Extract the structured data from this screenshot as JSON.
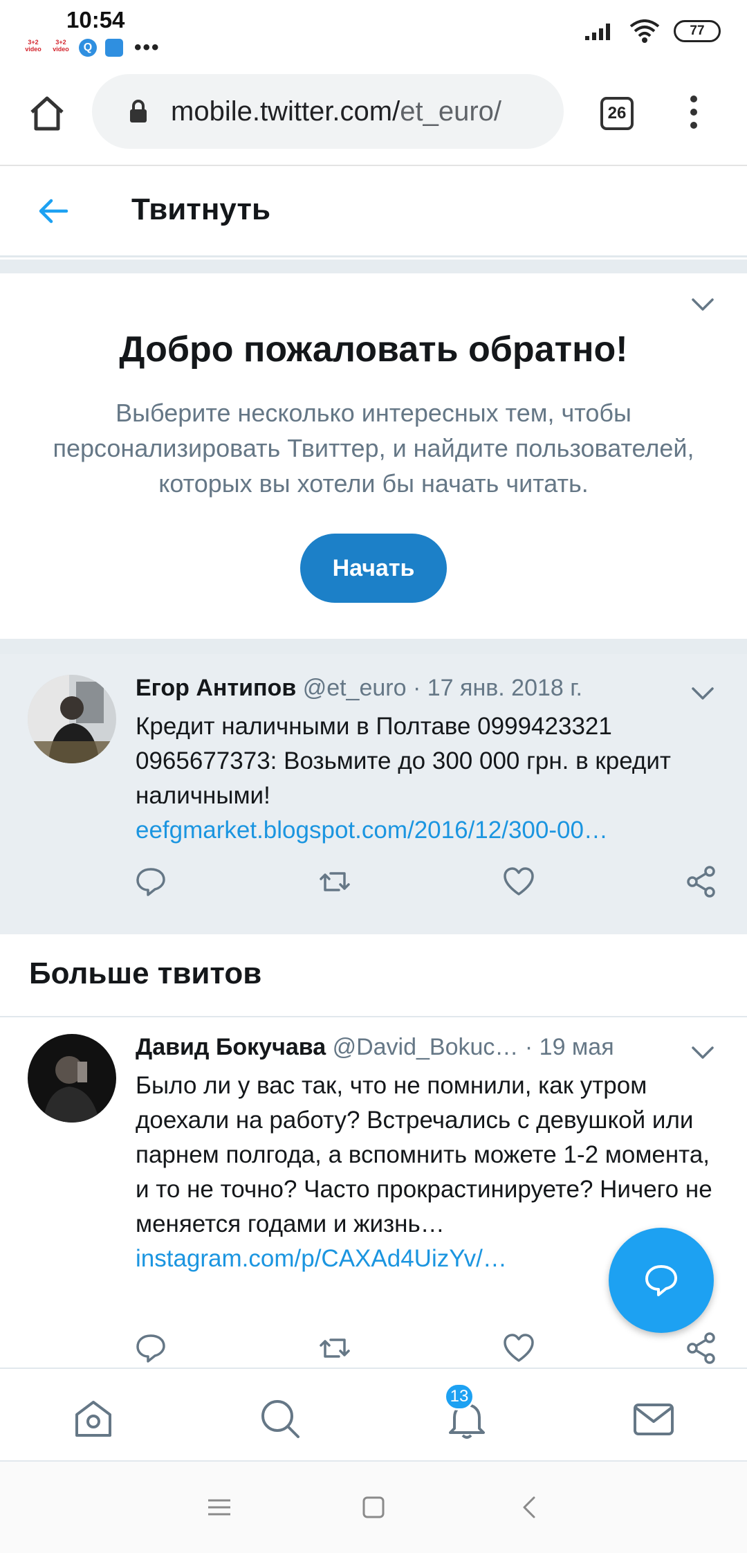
{
  "status_bar": {
    "time": "10:54",
    "apps": [
      "3+2 video",
      "3+2 video"
    ],
    "more": "•••",
    "battery": "77"
  },
  "browser": {
    "url_main": "mobile.twitter.com/",
    "url_path": "et_euro/",
    "tab_count": "26"
  },
  "header": {
    "title": "Твитнуть"
  },
  "welcome": {
    "title": "Добро пожаловать обратно!",
    "text": "Выберите несколько интересных тем, чтобы персонализировать Твиттер, и найдите пользователей, которых вы хотели бы начать читать.",
    "button": "Начать"
  },
  "main_tweet": {
    "name": "Егор Антипов",
    "handle": "@et_euro",
    "dot": "·",
    "date": "17 янв. 2018 г.",
    "text": "Кредит наличными в Полтаве 0999423321 0965677373: Возьмите до 300 000 грн. в кредит наличными!",
    "link": "eefgmarket.blogspot.com/2016/12/300-00…"
  },
  "more_section": {
    "title": "Больше твитов"
  },
  "second_tweet": {
    "name": "Давид Бокучава",
    "handle": "@David_Bokuc…",
    "dot": "·",
    "date": "19 мая",
    "text": "Было ли у вас так, что не помнили, как утром доехали на работу? Встречались с девушкой или парнем полгода, а вспомнить можете 1-2 момента, и то не точно? Часто прокрастинируете? Ничего не меняется годами и жизнь…",
    "link": "instagram.com/p/CAXAd4UizYv/…"
  },
  "bottom_nav": {
    "notifications_count": "13"
  },
  "colors": {
    "accent": "#1da1f2",
    "button": "#1c80c8",
    "link": "#1b95e0",
    "muted": "#657786"
  }
}
